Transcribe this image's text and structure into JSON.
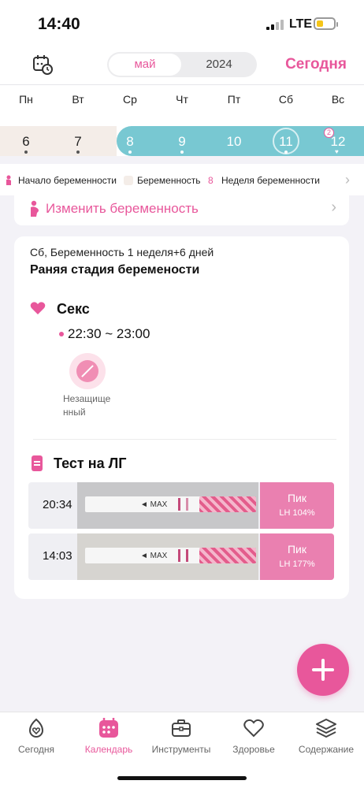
{
  "status_bar": {
    "time": "14:40",
    "network": "LTE"
  },
  "header": {
    "month": "май",
    "year": "2024",
    "today": "Сегодня"
  },
  "weekdays": [
    "Пн",
    "Вт",
    "Ср",
    "Чт",
    "Пт",
    "Сб",
    "Вс"
  ],
  "dates": [
    "6",
    "7",
    "8",
    "9",
    "10",
    "11",
    "12"
  ],
  "date_badge": "2",
  "legend": {
    "start": "Начало беременности",
    "pregnancy": "Беременность",
    "week_num": "8",
    "week": "Неделя беременности"
  },
  "change_pregnancy": "Изменить беременность",
  "day_card": {
    "subtitle": "Сб, Беременность 1 неделя+6 дней",
    "stage": "Раняя стадия беремености",
    "sex": {
      "title": "Секс",
      "time": "22:30 ~ 23:00",
      "unprotected": "Незащище нный"
    },
    "lh_test": {
      "title": "Тест на ЛГ",
      "results": [
        {
          "time": "20:34",
          "label": "Пик",
          "value": "LH 104%"
        },
        {
          "time": "14:03",
          "label": "Пик",
          "value": "LH 177%"
        }
      ]
    }
  },
  "nav": {
    "items": [
      {
        "label": "Сегодня",
        "icon": "today-icon"
      },
      {
        "label": "Календарь",
        "icon": "calendar-icon"
      },
      {
        "label": "Инструменты",
        "icon": "tools-icon"
      },
      {
        "label": "Здоровье",
        "icon": "health-icon"
      },
      {
        "label": "Содержание",
        "icon": "content-icon"
      }
    ]
  },
  "colors": {
    "accent": "#e8579b",
    "pregnancy_band": "#78c8d2",
    "peak": "#ea80b0"
  }
}
